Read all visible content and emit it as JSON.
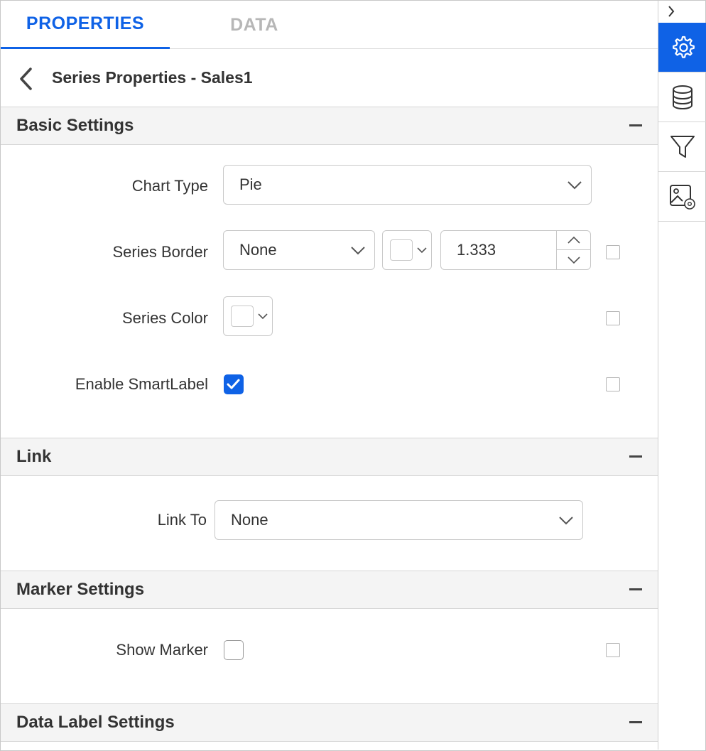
{
  "tabs": [
    {
      "label": "PROPERTIES",
      "active": true
    },
    {
      "label": "DATA",
      "active": false
    }
  ],
  "subheader": {
    "title": "Series Properties - Sales1"
  },
  "sections": {
    "basic": {
      "title": "Basic Settings"
    },
    "link": {
      "title": "Link"
    },
    "marker": {
      "title": "Marker Settings"
    },
    "data_label": {
      "title": "Data Label Settings"
    }
  },
  "basic_settings": {
    "chart_type": {
      "label": "Chart Type",
      "value": "Pie"
    },
    "series_border": {
      "label": "Series Border",
      "style_value": "None",
      "color": "#ffffff",
      "width_value": "1.333"
    },
    "series_color": {
      "label": "Series Color",
      "color": "#ffffff"
    },
    "enable_smartlabel": {
      "label": "Enable SmartLabel",
      "checked": true
    }
  },
  "link_settings": {
    "link_to": {
      "label": "Link To",
      "value": "None"
    }
  },
  "marker_settings": {
    "show_marker": {
      "label": "Show Marker",
      "checked": false
    }
  },
  "rail": {
    "items": [
      {
        "icon": "gear-icon",
        "active": true
      },
      {
        "icon": "database-icon",
        "active": false
      },
      {
        "icon": "filter-icon",
        "active": false
      },
      {
        "icon": "image-settings-icon",
        "active": false
      }
    ]
  },
  "colors": {
    "accent": "#0f62e6",
    "inactive_tab": "#b7b7b7",
    "section_bg": "#f4f4f4"
  }
}
